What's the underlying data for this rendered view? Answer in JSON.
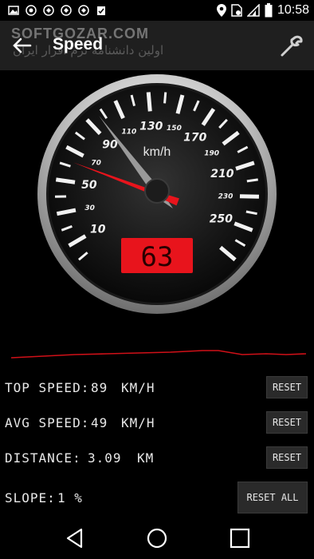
{
  "status_bar": {
    "time": "10:58"
  },
  "app_bar": {
    "title": "Speed",
    "watermark": "SOFTGOZAR.COM",
    "watermark_sub": "اولین دانشنامه نرم افزار ایران"
  },
  "gauge": {
    "unit": "km/h",
    "speed_display": "63",
    "needle_speed": 63,
    "major_labels": [
      "10",
      "50",
      "90",
      "130",
      "170",
      "210",
      "250"
    ],
    "minor_labels": [
      "30",
      "70",
      "110",
      "150",
      "190",
      "230"
    ],
    "display_color": "#e8141c",
    "needle_color": "#e8141c"
  },
  "stats": {
    "top_speed": {
      "label": "TOP SPEED:",
      "value": "89",
      "unit": "KM/H",
      "button": "RESET"
    },
    "avg_speed": {
      "label": "AVG SPEED:",
      "value": "49",
      "unit": "KM/H",
      "button": "RESET"
    },
    "distance": {
      "label": "DISTANCE:",
      "value": "3.09",
      "unit": "KM",
      "button": "RESET"
    },
    "slope": {
      "label": "SLOPE:",
      "value": "1 %",
      "button": "RESET ALL"
    }
  }
}
